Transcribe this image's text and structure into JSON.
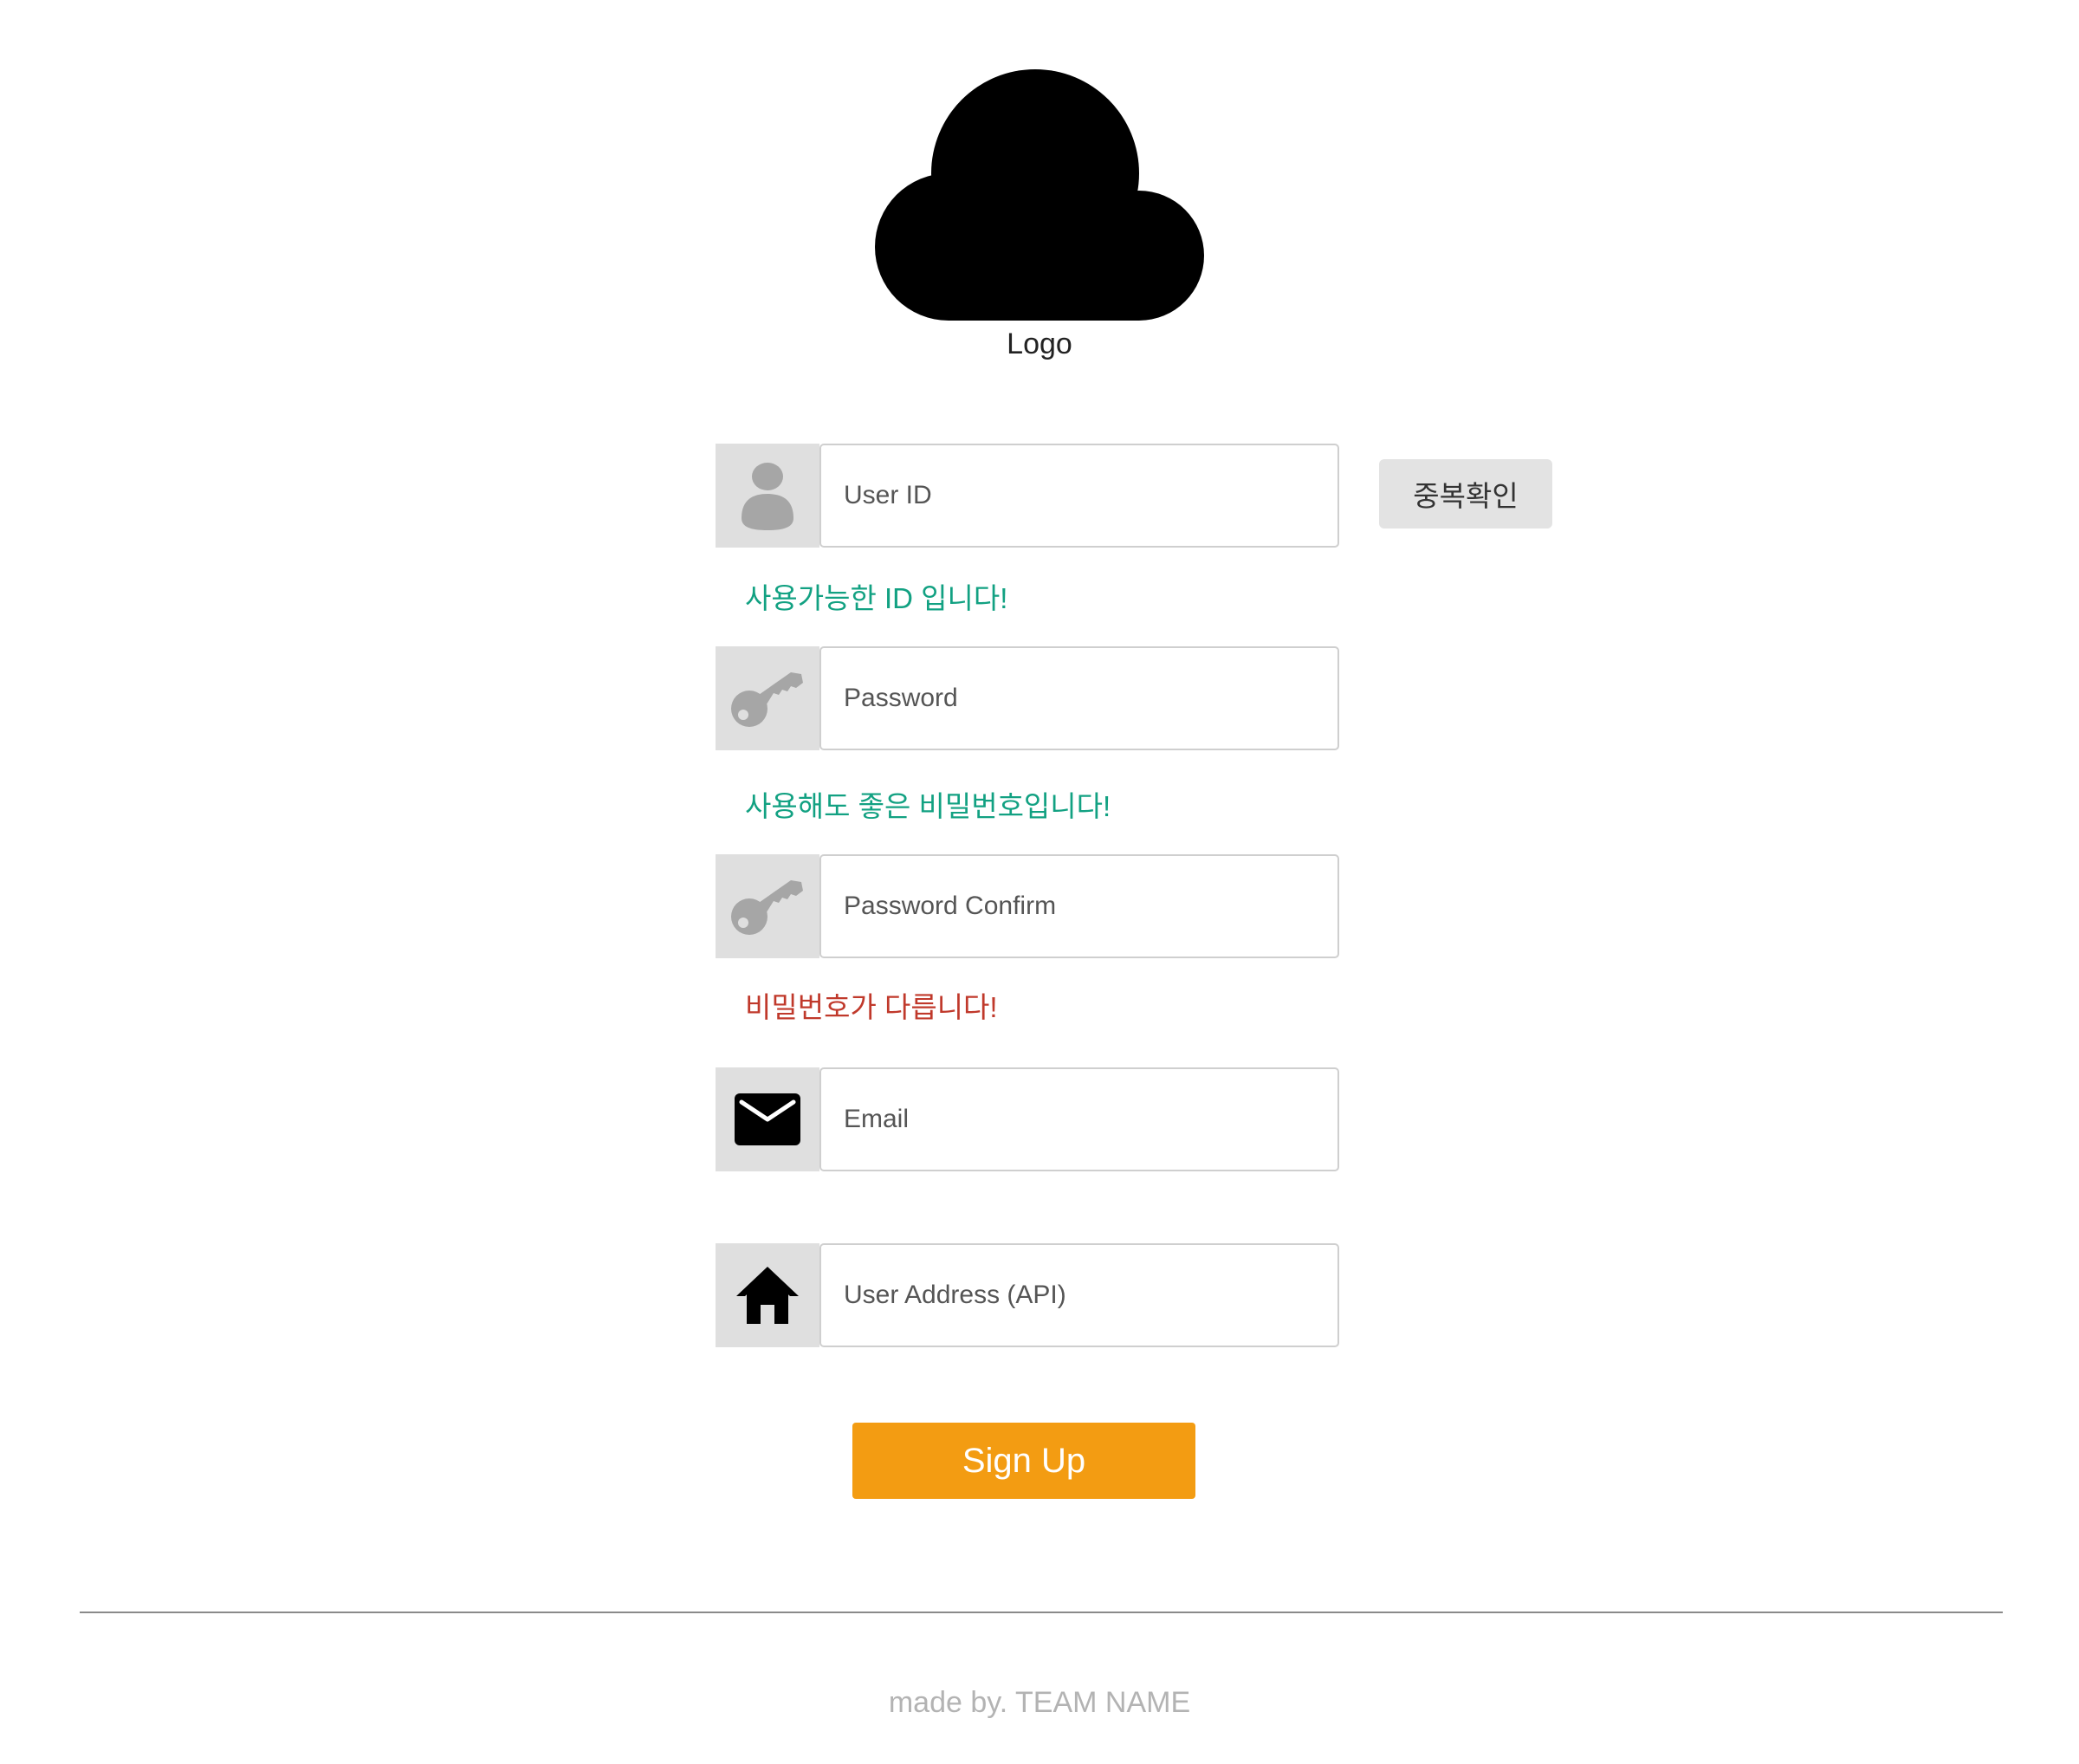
{
  "logo": {
    "icon": "cloud-icon",
    "caption": "Logo"
  },
  "form": {
    "user_id": {
      "placeholder": "User ID",
      "icon": "user-icon",
      "check_button_label": "중복확인",
      "message": "사용가능한 ID 입니다!",
      "message_status": "ok"
    },
    "password": {
      "placeholder": "Password",
      "icon": "key-icon",
      "message": "사용해도 좋은 비밀번호입니다!",
      "message_status": "ok"
    },
    "password_confirm": {
      "placeholder": "Password Confirm",
      "icon": "key-icon",
      "message": "비밀번호가 다릅니다!",
      "message_status": "error"
    },
    "email": {
      "placeholder": "Email",
      "icon": "envelope-icon"
    },
    "address": {
      "placeholder": "User Address (API)",
      "icon": "home-icon"
    },
    "submit_label": "Sign Up"
  },
  "footer": {
    "text": "made by. TEAM NAME"
  },
  "colors": {
    "accent": "#f39c12",
    "success": "#12a182",
    "error": "#c0392b",
    "icon_bg": "#dfdfdf",
    "icon_muted": "#a6a6a6"
  }
}
